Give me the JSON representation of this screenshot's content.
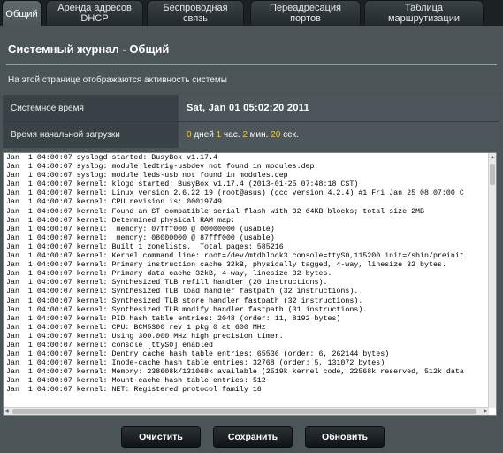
{
  "tabs": [
    {
      "label": "Общий",
      "active": true
    },
    {
      "label": "Аренда адресов DHCP",
      "active": false
    },
    {
      "label": "Беспроводная связь",
      "active": false
    },
    {
      "label": "Переадресация портов",
      "active": false
    },
    {
      "label": "Таблица маршрутизации",
      "active": false
    }
  ],
  "page": {
    "title": "Системный журнал - Общий",
    "description": "На этой странице отображаются активность системы"
  },
  "info": {
    "system_time_label": "Системное время",
    "system_time_value": "Sat, Jan 01  05:02:20  2011",
    "uptime_label": "Время начальной загрузки",
    "uptime": {
      "days": "0",
      "days_unit": "дней",
      "hours": "1",
      "hours_unit": "час.",
      "minutes": "2",
      "minutes_unit": "мин.",
      "seconds": "20",
      "seconds_unit": "сек."
    }
  },
  "log_text": "Jan  1 04:00:07 syslogd started: BusyBox v1.17.4\nJan  1 04:00:07 syslog: module ledtrig-usbdev not found in modules.dep\nJan  1 04:00:07 syslog: module leds-usb not found in modules.dep\nJan  1 04:00:07 kernel: klogd started: BusyBox v1.17.4 (2013-01-25 07:48:18 CST)\nJan  1 04:00:07 kernel: Linux version 2.6.22.19 (root@asus) (gcc version 4.2.4) #1 Fri Jan 25 08:07:00 C\nJan  1 04:00:07 kernel: CPU revision is: 00019749\nJan  1 04:00:07 kernel: Found an ST compatible serial flash with 32 64KB blocks; total size 2MB\nJan  1 04:00:07 kernel: Determined physical RAM map:\nJan  1 04:00:07 kernel:  memory: 07fff000 @ 00000000 (usable)\nJan  1 04:00:07 kernel:  memory: 08000000 @ 87fff000 (usable)\nJan  1 04:00:07 kernel: Built 1 zonelists.  Total pages: 585216\nJan  1 04:00:07 kernel: Kernel command line: root=/dev/mtdblock3 console=ttyS0,115200 init=/sbin/preinit\nJan  1 04:00:07 kernel: Primary instruction cache 32kB, physically tagged, 4-way, linesize 32 bytes.\nJan  1 04:00:07 kernel: Primary data cache 32kB, 4-way, linesize 32 bytes.\nJan  1 04:00:07 kernel: Synthesized TLB refill handler (20 instructions).\nJan  1 04:00:07 kernel: Synthesized TLB load handler fastpath (32 instructions).\nJan  1 04:00:07 kernel: Synthesized TLB store handler fastpath (32 instructions).\nJan  1 04:00:07 kernel: Synthesized TLB modify handler fastpath (31 instructions).\nJan  1 04:00:07 kernel: PID hash table entries: 2048 (order: 11, 8192 bytes)\nJan  1 04:00:07 kernel: CPU: BCM5300 rev 1 pkg 0 at 600 MHz\nJan  1 04:00:07 kernel: Using 300.000 MHz high precision timer.\nJan  1 04:00:07 kernel: console [ttyS0] enabled\nJan  1 04:00:07 kernel: Dentry cache hash table entries: 65536 (order: 6, 262144 bytes)\nJan  1 04:00:07 kernel: Inode-cache hash table entries: 32768 (order: 5, 131072 bytes)\nJan  1 04:00:07 kernel: Memory: 238608k/131068k available (2519k kernel code, 22568k reserved, 512k data\nJan  1 04:00:07 kernel: Mount-cache hash table entries: 512\nJan  1 04:00:07 kernel: NET: Registered protocol family 16",
  "buttons": {
    "clear": "Очистить",
    "save": "Сохранить",
    "refresh": "Обновить"
  }
}
